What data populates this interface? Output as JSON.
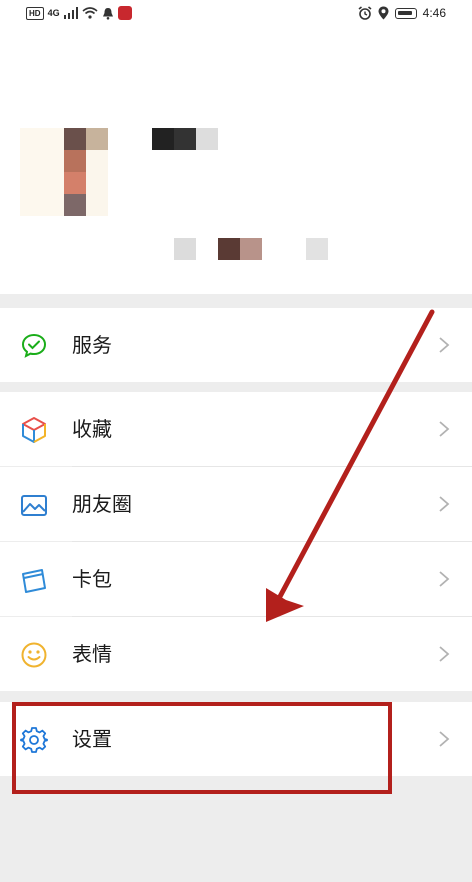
{
  "status_bar": {
    "network_badge": "HD",
    "network_type": "4G",
    "time": "4:46"
  },
  "menu": {
    "services": {
      "label": "服务",
      "icon": "chat-check-icon"
    },
    "favorites": {
      "label": "收藏",
      "icon": "cube-icon"
    },
    "moments": {
      "label": "朋友圈",
      "icon": "picture-icon"
    },
    "cards": {
      "label": "卡包",
      "icon": "card-icon"
    },
    "stickers": {
      "label": "表情",
      "icon": "smiley-icon"
    },
    "settings": {
      "label": "设置",
      "icon": "gear-icon"
    }
  },
  "colors": {
    "annotation": "#b3201c",
    "services_icon": "#1aad19",
    "settings_icon": "#1e77d8"
  }
}
